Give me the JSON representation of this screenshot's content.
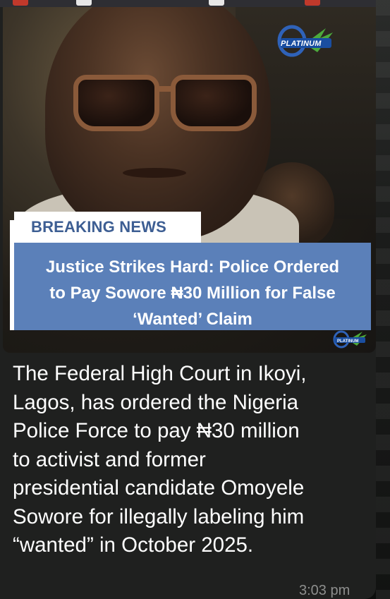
{
  "post": {
    "image": {
      "logo_text": "PLATINUM",
      "mini_logo_text": "PLATINUM",
      "breaking_label": "BREAKING NEWS",
      "headline_line1": "Justice Strikes Hard: Police Ordered",
      "headline_line2": "to Pay Sowore ₦30 Million for False",
      "headline_line3": "‘Wanted’ Claim"
    },
    "caption_lines": [
      "The Federal High Court in Ikoyi,",
      "Lagos, has ordered the Nigeria",
      "Police Force to pay ₦30 million",
      "to activist and former",
      "presidential candidate Omoyele",
      "Sowore for illegally labeling him",
      "“wanted” in October 2025."
    ],
    "timestamp": "3:03 pm"
  },
  "colors": {
    "banner_blue": "#5b80b9",
    "breaking_text": "#3d5e93",
    "bubble_bg": "#1f201f",
    "timestamp": "#8d8e8d"
  },
  "icons": [
    "platinum-tv-logo-icon",
    "platinum-tv-mini-logo-icon"
  ]
}
